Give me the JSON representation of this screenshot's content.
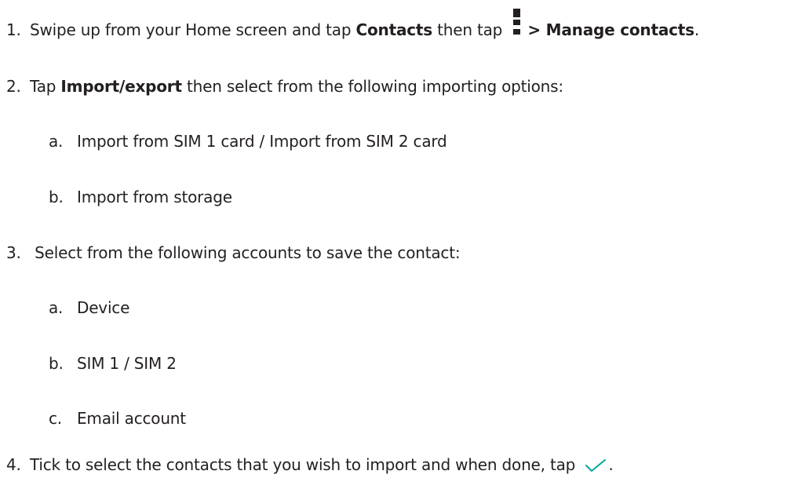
{
  "steps": [
    {
      "number": "1.",
      "text_a": "Swipe up from your Home screen and tap ",
      "bold_a": "Contacts",
      "text_b": " then tap ",
      "icon": "more-vert-icon",
      "bold_b": "> Manage contacts",
      "text_c": "."
    },
    {
      "number": "2.",
      "text_a": "Tap ",
      "bold_a": "Import/export",
      "text_b": " then select from the following importing options:",
      "options": [
        {
          "letter": "a.",
          "text": "Import from SIM 1 card / Import from SIM 2 card"
        },
        {
          "letter": "b.",
          "text": "Import from storage"
        }
      ]
    },
    {
      "number": "3.",
      "text_a": " Select from the following accounts to save the contact:",
      "options": [
        {
          "letter": "a.",
          "text": "Device"
        },
        {
          "letter": "b.",
          "text": "SIM 1 / SIM 2"
        },
        {
          "letter": "c.",
          "text": "Email account"
        }
      ]
    },
    {
      "number": "4.",
      "text_a": "Tick to select the contacts that you wish to import and when done, tap ",
      "icon": "check-icon",
      "icon_color": "#00a99d",
      "text_b": "."
    }
  ]
}
